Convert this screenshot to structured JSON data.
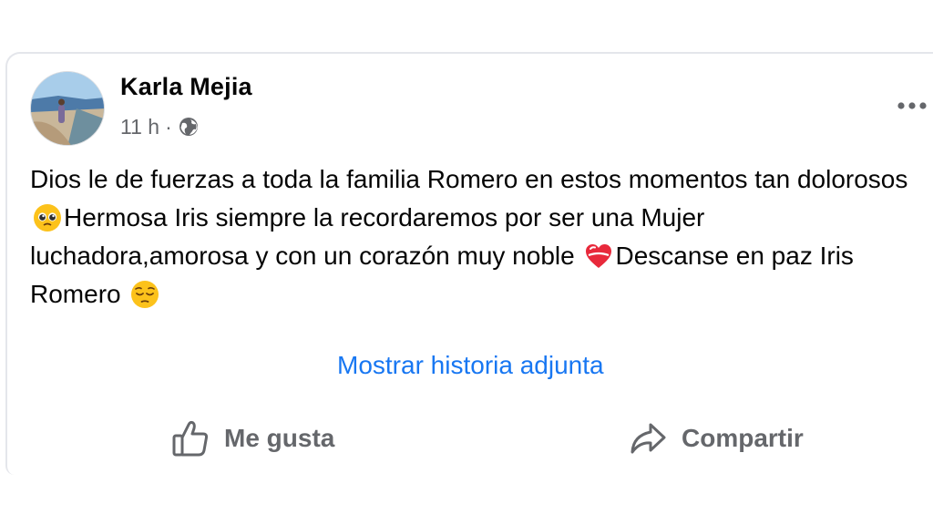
{
  "post": {
    "author": "Karla Mejia",
    "time": "11 h",
    "separator": "·",
    "audience_icon": "globe-icon",
    "text_parts": {
      "p1": "Dios le de fuerzas a toda la familia Romero en estos momentos tan dolorosos ",
      "emoji1": "pleading-face-emoji",
      "p2": "Hermosa Iris siempre la recordaremos por ser una Mujer luchadora,amorosa y con un corazón muy noble ",
      "emoji2": "heart-emoji",
      "p3": "Descanse en paz Iris Romero ",
      "emoji3": "pensive-face-emoji"
    },
    "show_story_link": "Mostrar historia adjunta"
  },
  "actions": {
    "like_label": "Me gusta",
    "like_icon": "thumbs-up-icon",
    "share_label": "Compartir",
    "share_icon": "share-arrow-icon"
  },
  "colors": {
    "link": "#1877f2",
    "secondary_text": "#65676b",
    "primary_text": "#050505"
  }
}
